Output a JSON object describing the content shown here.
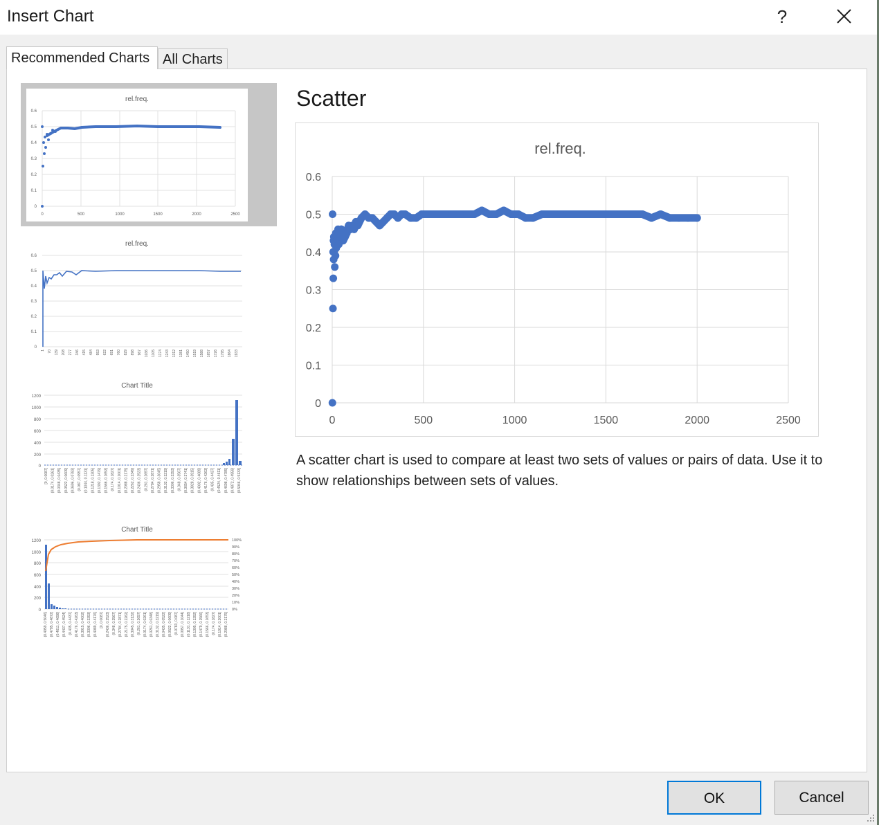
{
  "dialog": {
    "title": "Insert Chart",
    "help_label": "?",
    "close_icon": "close-icon"
  },
  "tabs": [
    {
      "label": "Recommended Charts",
      "active": true
    },
    {
      "label": "All Charts",
      "active": false
    }
  ],
  "thumbnails": [
    {
      "name": "scatter",
      "title": "rel.freq.",
      "selected": true,
      "y_ticks": [
        "0.6",
        "0.5",
        "0.4",
        "0.3",
        "0.2",
        "0.1",
        "0"
      ],
      "x_ticks": [
        "0",
        "500",
        "1000",
        "1500",
        "2000",
        "2500"
      ]
    },
    {
      "name": "line",
      "title": "rel.freq.",
      "selected": false,
      "y_ticks": [
        "0.6",
        "0.5",
        "0.4",
        "0.3",
        "0.2",
        "0.1",
        "0"
      ],
      "x_ticks": [
        "1",
        "70",
        "139",
        "208",
        "277",
        "346",
        "415",
        "484",
        "553",
        "622",
        "691",
        "760",
        "829",
        "898",
        "967",
        "1036",
        "1105",
        "1174",
        "1243",
        "1312",
        "1381",
        "1450",
        "1519",
        "1588",
        "1657",
        "1726",
        "1795",
        "1864",
        "1933"
      ]
    },
    {
      "name": "histogram",
      "title": "Chart Title",
      "selected": false,
      "y_ticks": [
        "1200",
        "1000",
        "800",
        "600",
        "400",
        "200",
        "0"
      ],
      "x_ticks": [
        "[0, 0.0087]",
        "(0.0174, 0.0261]",
        "(0.0348, 0.0435]",
        "(0.0522, 0.0609]",
        "(0.0696, 0.0783]",
        "(0.087, 0.0957]",
        "(0.1044, 0.1131]",
        "(0.1218, 0.1305]",
        "(0.1392, 0.1479]",
        "(0.1566, 0.1653]",
        "(0.174, 0.1827]",
        "(0.1914, 0.2001]",
        "(0.2088, 0.2175]",
        "(0.2262, 0.2349]",
        "(0.2436, 0.2523]",
        "(0.261, 0.2697]",
        "(0.2784, 0.2871]",
        "(0.2958, 0.3045]",
        "(0.3132, 0.3219]",
        "(0.3306, 0.3393]",
        "(0.348, 0.3567]",
        "(0.3654, 0.3741]",
        "(0.3828, 0.3915]",
        "(0.4002, 0.4089]",
        "(0.4176, 0.4263]",
        "(0.435, 0.4437]",
        "(0.4524, 0.4611]",
        "(0.4698, 0.4785]",
        "(0.4872, 0.4959]",
        "(0.5046, 0.5133]"
      ]
    },
    {
      "name": "pareto",
      "title": "Chart Title",
      "selected": false,
      "y_ticks": [
        "1200",
        "1000",
        "800",
        "600",
        "400",
        "200",
        "0"
      ],
      "y2_ticks": [
        "100%",
        "90%",
        "80%",
        "70%",
        "60%",
        "50%",
        "40%",
        "30%",
        "20%",
        "10%",
        "0%"
      ],
      "x_ticks": [
        "(0.4959, 0.5046]",
        "(0.4785, 0.4872]",
        "(0.4611, 0.4698]",
        "(0.4437, 0.4524]",
        "(0.435, 0.4437]",
        "(0.4176, 0.4263]",
        "(0.3915, 0.4002]",
        "(0.3306, 0.3393]",
        "(0.4089, 0.4176]",
        "[0, 0.0087]",
        "(0.2436, 0.2523]",
        "(0.348, 0.3567]",
        "(0.2784, 0.2871]",
        "(0.2175, 0.2262]",
        "(0.3045, 0.3132]",
        "(0.261, 0.2697]",
        "(0.0174, 0.0261]",
        "(0.0261, 0.0348]",
        "(0.3132, 0.3219]",
        "(0.0435, 0.0522]",
        "(0.0522, 0.0609]",
        "(0.0783, 0.087]",
        "(0.0957, 0.1044]",
        "(0.1131, 0.1218]",
        "(0.1305, 0.1392]",
        "(0.1479, 0.1566]",
        "(0.1566, 0.1653]",
        "(0.174, 0.1827]",
        "(0.1914, 0.2001]",
        "(0.2088, 0.2175]"
      ]
    }
  ],
  "preview": {
    "heading": "Scatter",
    "description": "A scatter chart is used to compare at least two sets of values or pairs of data. Use it to show relationships between sets of values."
  },
  "chart_data": {
    "type": "scatter",
    "title": "rel.freq.",
    "xlabel": "",
    "ylabel": "",
    "xlim": [
      0,
      2500
    ],
    "ylim": [
      0,
      0.6
    ],
    "x_ticks": [
      "0",
      "500",
      "1000",
      "1500",
      "2000",
      "2500"
    ],
    "y_ticks": [
      "0",
      "0.1",
      "0.2",
      "0.3",
      "0.4",
      "0.5",
      "0.6"
    ],
    "grid": true,
    "series_color": "#4472c4",
    "x": [
      1,
      2,
      4,
      5,
      6,
      7,
      8,
      9,
      10,
      12,
      14,
      16,
      18,
      20,
      22,
      25,
      28,
      32,
      36,
      40,
      45,
      50,
      55,
      60,
      70,
      80,
      90,
      100,
      110,
      120,
      130,
      140,
      160,
      180,
      200,
      220,
      240,
      260,
      280,
      300,
      320,
      340,
      360,
      380,
      400,
      430,
      460,
      490,
      520,
      550,
      580,
      620,
      660,
      700,
      740,
      780,
      820,
      860,
      900,
      940,
      980,
      1020,
      1060,
      1100,
      1150,
      1200,
      1250,
      1300,
      1350,
      1400,
      1450,
      1500,
      1550,
      1600,
      1650,
      1700,
      1750,
      1800,
      1850,
      1900,
      1950,
      2000
    ],
    "y": [
      0,
      0.5,
      0.25,
      0.4,
      0.33,
      0.43,
      0.38,
      0.44,
      0.4,
      0.42,
      0.36,
      0.44,
      0.39,
      0.45,
      0.41,
      0.44,
      0.43,
      0.46,
      0.42,
      0.45,
      0.44,
      0.46,
      0.45,
      0.43,
      0.44,
      0.45,
      0.47,
      0.46,
      0.47,
      0.46,
      0.48,
      0.47,
      0.49,
      0.5,
      0.49,
      0.49,
      0.48,
      0.47,
      0.48,
      0.49,
      0.5,
      0.5,
      0.49,
      0.5,
      0.5,
      0.49,
      0.49,
      0.5,
      0.5,
      0.5,
      0.5,
      0.5,
      0.5,
      0.5,
      0.5,
      0.5,
      0.51,
      0.5,
      0.5,
      0.51,
      0.5,
      0.5,
      0.49,
      0.49,
      0.5,
      0.5,
      0.5,
      0.5,
      0.5,
      0.5,
      0.5,
      0.5,
      0.5,
      0.5,
      0.5,
      0.5,
      0.49,
      0.5,
      0.49,
      0.49,
      0.49,
      0.49
    ]
  },
  "buttons": {
    "ok_label": "OK",
    "cancel_label": "Cancel"
  }
}
